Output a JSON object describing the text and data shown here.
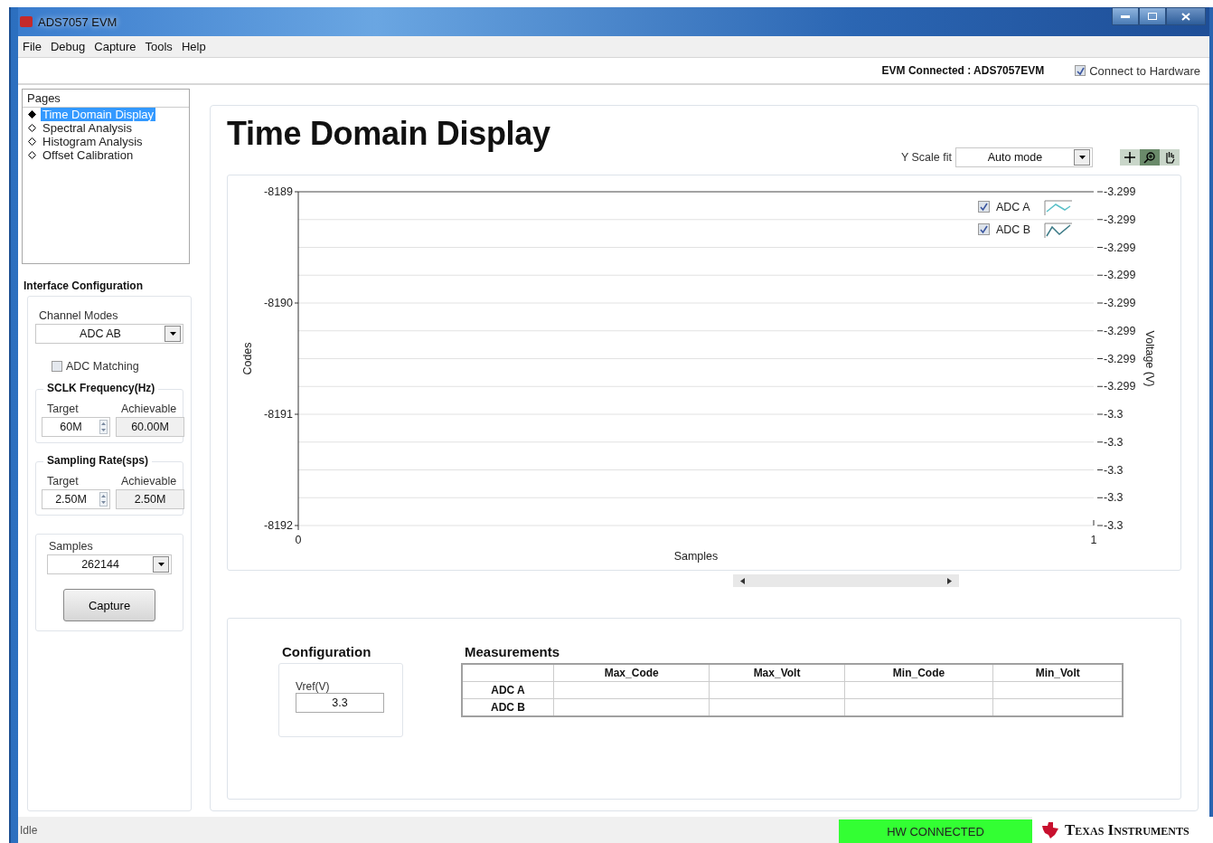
{
  "window": {
    "title": "ADS7057 EVM"
  },
  "menu": [
    "File",
    "Debug",
    "Capture",
    "Tools",
    "Help"
  ],
  "top_bar": {
    "status": "EVM Connected : ADS7057EVM",
    "connect": {
      "label": "Connect to Hardware",
      "checked": true
    }
  },
  "pages": {
    "title": "Pages",
    "items": [
      {
        "label": "Time Domain Display",
        "selected": true
      },
      {
        "label": "Spectral Analysis",
        "selected": false
      },
      {
        "label": "Histogram Analysis",
        "selected": false
      },
      {
        "label": "Offset Calibration",
        "selected": false
      }
    ]
  },
  "interface": {
    "title": "Interface Configuration",
    "channel_modes": {
      "label": "Channel Modes",
      "value": "ADC AB"
    },
    "adc_matching": {
      "label": "ADC Matching",
      "checked": false
    },
    "groups": [
      {
        "title": "SCLK Frequency(Hz)",
        "target_label": "Target",
        "target": "60M",
        "achievable_label": "Achievable",
        "achievable": "60.00M"
      },
      {
        "title": "Sampling Rate(sps)",
        "target_label": "Target",
        "target": "2.50M",
        "achievable_label": "Achievable",
        "achievable": "2.50M"
      }
    ],
    "samples": {
      "label": "Samples",
      "value": "262144"
    },
    "capture_button": "Capture"
  },
  "main": {
    "title": "Time Domain Display",
    "y_scale": {
      "label": "Y Scale fit",
      "value": "Auto mode"
    },
    "chart": {
      "legend": [
        {
          "label": "ADC A",
          "checked": true,
          "color": "#5bc0c8"
        },
        {
          "label": "ADC B",
          "checked": true,
          "color": "#3c7a86"
        }
      ],
      "right_axis": {
        "label": "Voltage (V)",
        "ticks": [
          "-3.299",
          "-3.299",
          "-3.299",
          "-3.299",
          "-3.299",
          "-3.299",
          "-3.299",
          "-3.299",
          "-3.3",
          "-3.3",
          "-3.3",
          "-3.3",
          "-3.3"
        ]
      },
      "chart_data": {
        "type": "line",
        "xlabel": "Samples",
        "ylabel": "Codes",
        "xlim": [
          0,
          1
        ],
        "ylim": [
          -8192,
          -8189
        ],
        "xticks": [
          0,
          1
        ],
        "yticks": [
          -8189,
          -8190,
          -8191,
          -8192
        ]
      }
    },
    "configuration": {
      "title": "Configuration",
      "vref_label": "Vref(V)",
      "vref": "3.3"
    },
    "measurements": {
      "title": "Measurements",
      "columns": [
        "Max_Code",
        "Max_Volt",
        "Min_Code",
        "Min_Volt"
      ],
      "rows": [
        "ADC A",
        "ADC B"
      ]
    }
  },
  "status_bar": {
    "text": "Idle",
    "connection": "HW CONNECTED",
    "logo": "Texas Instruments"
  }
}
